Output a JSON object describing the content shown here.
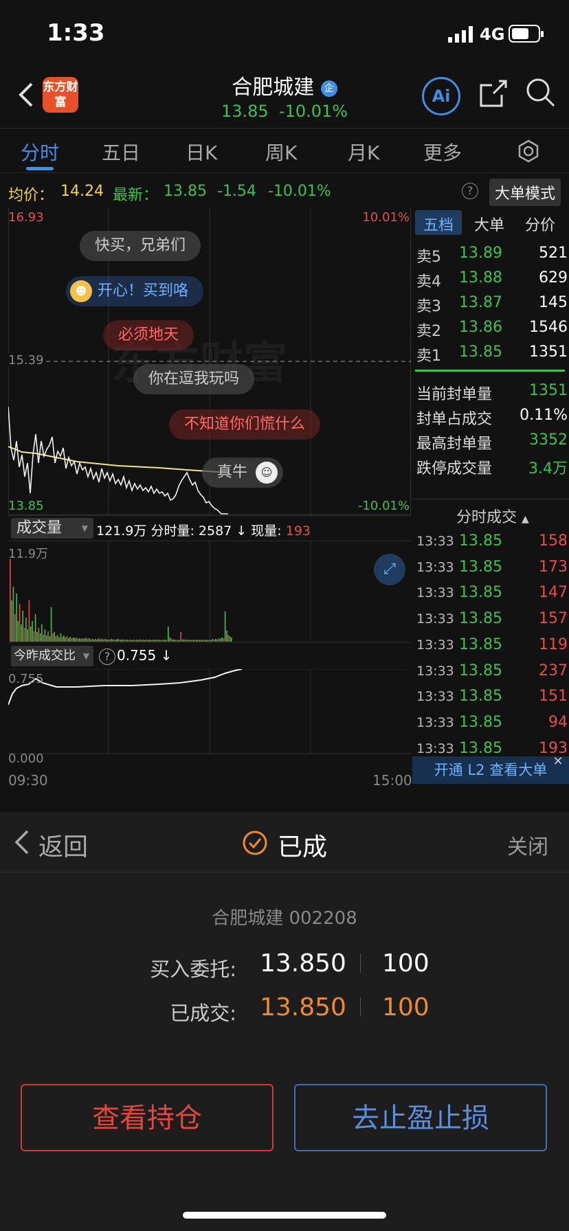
{
  "status_bar": {
    "time": "1:33",
    "network": "4G"
  },
  "header": {
    "logo_text": "东方财富",
    "stock_name": "合肥城建",
    "enterprise_badge": "企",
    "price": "13.85",
    "change_pct": "-10.01%",
    "ai_label": "Ai"
  },
  "tabs": [
    {
      "label": "分时",
      "active": true
    },
    {
      "label": "五日"
    },
    {
      "label": "日K"
    },
    {
      "label": "周K"
    },
    {
      "label": "月K"
    },
    {
      "label": "更多"
    }
  ],
  "quote_line": {
    "avg_label": "均价：",
    "avg_value": "14.24",
    "latest_label": "最新：",
    "latest_value": "13.85",
    "change": "-1.54",
    "change_pct": "-10.01%",
    "help": "?",
    "big_order_mode": "大单模式"
  },
  "intraday_chart": {
    "high_price": "16.93",
    "high_pct": "10.01%",
    "mid_price": "15.39",
    "low_price": "13.85",
    "low_pct": "-10.01%",
    "watermark": "东方财富"
  },
  "danmu": [
    "快买，兄弟们",
    "开心！买到咯",
    "必须地天",
    "你在逗我玩吗",
    "不知道你们慌什么",
    "真牛"
  ],
  "volume_panel": {
    "selector": "成交量",
    "total": "121.9万",
    "minute_label": "分时量:",
    "minute_value": "2587",
    "current_label": "现量:",
    "current_value": "193",
    "max_label": "11.9万"
  },
  "ratio_panel": {
    "selector": "今昨成交比",
    "help": "?",
    "value": "0.755",
    "top_label": "0.755",
    "bottom_label": "0.000",
    "time_start": "09:30",
    "time_end": "15:00"
  },
  "order_book": {
    "tabs": [
      "五档",
      "大单",
      "分价"
    ],
    "asks": [
      {
        "label": "卖5",
        "price": "13.89",
        "volume": "521"
      },
      {
        "label": "卖4",
        "price": "13.88",
        "volume": "629"
      },
      {
        "label": "卖3",
        "price": "13.87",
        "volume": "145"
      },
      {
        "label": "卖2",
        "price": "13.86",
        "volume": "1546"
      },
      {
        "label": "卖1",
        "price": "13.85",
        "volume": "1351"
      }
    ],
    "seal_stats": [
      {
        "label": "当前封单量",
        "value": "1351"
      },
      {
        "label": "封单占成交",
        "value": "0.11%"
      },
      {
        "label": "最高封单量",
        "value": "3352"
      },
      {
        "label": "跌停成交量",
        "value": "3.4万"
      }
    ]
  },
  "trades": {
    "title": "分时成交",
    "rows": [
      {
        "time": "13:33",
        "price": "13.85",
        "vol": "158"
      },
      {
        "time": "13:33",
        "price": "13.85",
        "vol": "173"
      },
      {
        "time": "13:33",
        "price": "13.85",
        "vol": "147"
      },
      {
        "time": "13:33",
        "price": "13.85",
        "vol": "157"
      },
      {
        "time": "13:33",
        "price": "13.85",
        "vol": "119"
      },
      {
        "time": "13:33",
        "price": "13.85",
        "vol": "237"
      },
      {
        "time": "13:33",
        "price": "13.85",
        "vol": "151"
      },
      {
        "time": "13:33",
        "price": "13.85",
        "vol": "94"
      },
      {
        "time": "13:33",
        "price": "13.85",
        "vol": "193"
      }
    ],
    "l2_banner": "开通 L2 查看大单"
  },
  "sheet": {
    "back": "返回",
    "status": "已成",
    "close": "关闭",
    "stock": "合肥城建 002208",
    "order_label": "买入委托:",
    "order_price": "13.850",
    "order_qty": "100",
    "filled_label": "已成交:",
    "filled_price": "13.850",
    "filled_qty": "100",
    "btn_position": "查看持仓",
    "btn_stop": "去止盈止损"
  },
  "colors": {
    "up": "#e84d4d",
    "down": "#3cc34e",
    "accent": "#3f8ee8",
    "orange": "#f08a30"
  }
}
